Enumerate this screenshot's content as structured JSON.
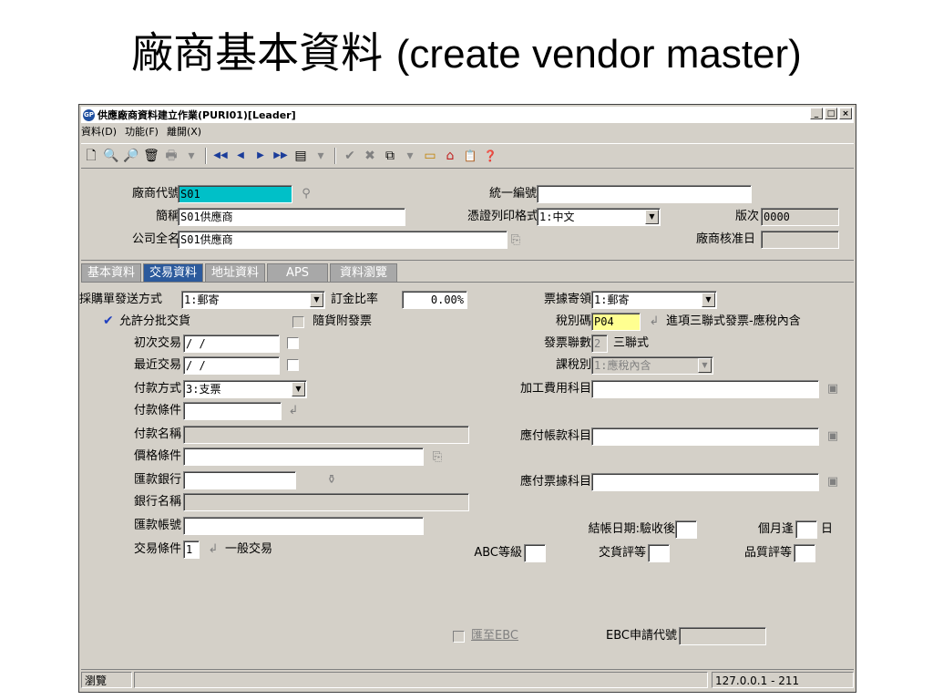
{
  "slide": {
    "title_zh": "廠商基本資料",
    "title_en": "(create vendor master)"
  },
  "window": {
    "app_icon": "GP",
    "title": "供應廠商資料建立作業(PURI01)[Leader]",
    "controls": {
      "minimize": "_",
      "maximize": "□",
      "close": "×"
    }
  },
  "menu": [
    "資料(D)",
    "功能(F)",
    "離開(X)"
  ],
  "toolbar": {
    "left": [
      {
        "name": "new-doc-icon",
        "glyph": "🗋"
      },
      {
        "name": "preview-icon",
        "glyph": "🔍"
      },
      {
        "name": "search-icon",
        "glyph": "🔎"
      },
      {
        "name": "delete-icon",
        "glyph": "🗑"
      },
      {
        "name": "print-icon",
        "glyph": "🖶"
      },
      {
        "name": "dropdown-icon",
        "glyph": "▾"
      }
    ],
    "nav": [
      {
        "name": "first-record-icon",
        "glyph": "◀◀"
      },
      {
        "name": "prev-record-icon",
        "glyph": "◀"
      },
      {
        "name": "next-record-icon",
        "glyph": "▶"
      },
      {
        "name": "last-record-icon",
        "glyph": "▶▶"
      },
      {
        "name": "list-icon",
        "glyph": "▤"
      },
      {
        "name": "dropdown-icon",
        "glyph": "▾"
      }
    ],
    "actions": [
      {
        "name": "confirm-icon",
        "glyph": "✔"
      },
      {
        "name": "cancel-icon",
        "glyph": "✖"
      },
      {
        "name": "copy-icon",
        "glyph": "⧉"
      },
      {
        "name": "dropdown-icon",
        "glyph": "▾"
      },
      {
        "name": "folder-icon",
        "glyph": "▭"
      },
      {
        "name": "home-icon",
        "glyph": "⌂"
      },
      {
        "name": "clipboard-icon",
        "glyph": "📋"
      },
      {
        "name": "help-icon",
        "glyph": "❓"
      }
    ]
  },
  "header": {
    "vendor_code_label": "廠商代號",
    "vendor_code": "S01",
    "tax_id_label": "統一編號",
    "tax_id": "",
    "short_name_label": "簡稱",
    "short_name": "S01供應商",
    "print_format_label": "憑證列印格式",
    "print_format": "1:中文",
    "version_label": "版次",
    "version": "0000",
    "full_name_label": "公司全名",
    "full_name": "S01供應商",
    "approve_date_label": "廠商核准日",
    "approve_date": ""
  },
  "tabs": [
    "基本資料",
    "交易資料",
    "地址資料",
    "APS",
    "資料瀏覽"
  ],
  "active_tab": 1,
  "form": {
    "po_send_label": "採購單發送方式",
    "po_send": "1:郵寄",
    "deposit_label": "訂金比率",
    "deposit": "0.00%",
    "receipt_label": "票據寄領",
    "receipt": "1:郵寄",
    "partial_label": "允許分批交貨",
    "with_goods_label": "隨貨附發票",
    "tax_code_label": "稅別碼",
    "tax_code": "P04",
    "tax_code_desc": "進項三聯式發票-應稅內含",
    "first_trade_label": "初次交易",
    "first_trade": " /  /",
    "invoice_copies_label": "發票聯數",
    "invoice_copies": "2",
    "invoice_copies_desc": "三聯式",
    "last_trade_label": "最近交易",
    "last_trade": " /  /",
    "tax_type_label": "課稅別",
    "tax_type": "1:應稅內含",
    "pay_method_label": "付款方式",
    "pay_method": "3:支票",
    "process_acct_label": "加工費用科目",
    "process_acct": "",
    "pay_terms_label": "付款條件",
    "pay_terms": "",
    "pay_name_label": "付款名稱",
    "pay_name": "",
    "ap_acct_label": "應付帳款科目",
    "ap_acct": "",
    "price_terms_label": "價格條件",
    "price_terms": "",
    "remit_bank_label": "匯款銀行",
    "remit_bank": "",
    "np_acct_label": "應付票據科目",
    "np_acct": "",
    "bank_name_label": "銀行名稱",
    "bank_name": "",
    "remit_account_label": "匯款帳號",
    "remit_account": "",
    "close_date_label": "結帳日期:驗收後",
    "close_date": "",
    "month_label": "個月逢",
    "day_label": "日",
    "day_value": "",
    "trade_terms_label": "交易條件",
    "trade_terms": "1",
    "trade_terms_desc": "一般交易",
    "abc_label": "ABC等級",
    "abc": "",
    "delivery_rating_label": "交貨評等",
    "delivery_rating": "",
    "quality_rating_label": "品質評等",
    "quality_rating": "",
    "remit_ebc_label": "匯至EBC",
    "ebc_code_label": "EBC申請代號",
    "ebc_code": ""
  },
  "statusbar": {
    "mode": "瀏覽",
    "server": "127.0.0.1 - 211"
  }
}
